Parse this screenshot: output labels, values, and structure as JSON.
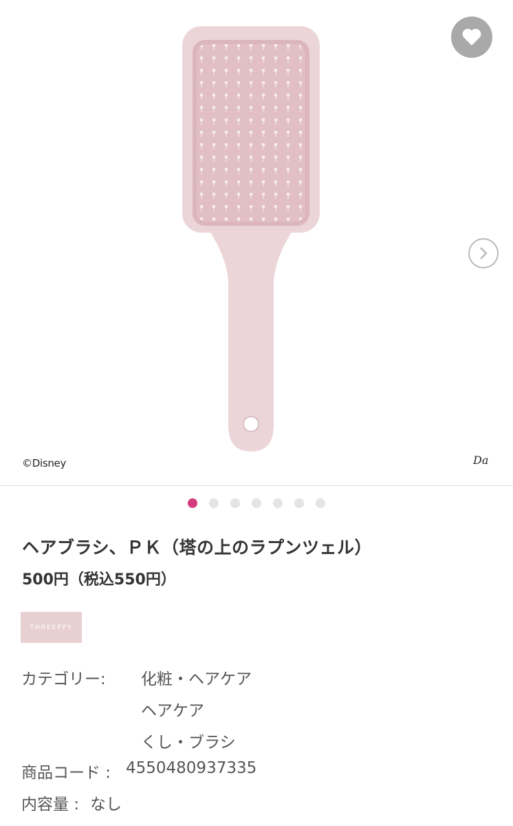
{
  "gallery": {
    "image_alt": "ヘアブラシ",
    "copyright": "©Disney",
    "brand_mark": "Da",
    "favorite_icon": "heart-icon",
    "next_icon": "chevron-right-icon",
    "slide_count": 7,
    "active_slide": 1,
    "accent_color": "#d63c7f"
  },
  "product": {
    "title": "ヘアブラシ、ＰＫ（塔の上のラプンツェル）",
    "price": "500円（税込550円）",
    "brand": "THREEPPY",
    "brand_color": "#e8cfd2"
  },
  "specs": {
    "category_label": "カテゴリー:",
    "categories": [
      "化粧・ヘアケア",
      "ヘアケア",
      "くし・ブラシ"
    ],
    "code_label": "商品コード :",
    "code_value": "4550480937335",
    "volume_label": "内容量 :",
    "volume_value": "なし"
  }
}
